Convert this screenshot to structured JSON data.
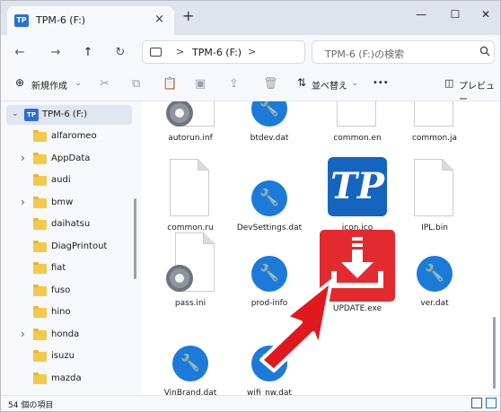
{
  "window": {
    "tab_title": "TPM-6 (F:)",
    "tab_close": "×",
    "new_tab": "+",
    "minimize": "—",
    "maximize": "☐",
    "close": "✕"
  },
  "nav": {
    "back": "←",
    "forward": "→",
    "up": "↑",
    "refresh": "↻"
  },
  "address": {
    "separator": ">",
    "crumb": "TPM-6 (F:)",
    "trail_separator": ">"
  },
  "search": {
    "placeholder": "TPM-6 (F:)の検索",
    "icon": "search-icon"
  },
  "commandbar": {
    "new_label": "新規作成",
    "new_icon": "⊕",
    "sort_label": "並べ替え",
    "more": "•••",
    "preview_label": "プレビュー",
    "disabled_icons": [
      "cut-icon",
      "copy-icon",
      "paste-icon",
      "rename-icon",
      "share-icon",
      "delete-icon"
    ]
  },
  "sidebar": {
    "drive": {
      "label": "TPM-6 (F:)",
      "badge": "TP"
    },
    "items": [
      {
        "label": "alfaromeo",
        "has_children": false
      },
      {
        "label": "AppData",
        "has_children": true
      },
      {
        "label": "audi",
        "has_children": false
      },
      {
        "label": "bmw",
        "has_children": true
      },
      {
        "label": "daihatsu",
        "has_children": false
      },
      {
        "label": "DiagPrintout",
        "has_children": false
      },
      {
        "label": "fiat",
        "has_children": false
      },
      {
        "label": "fuso",
        "has_children": false
      },
      {
        "label": "hino",
        "has_children": false
      },
      {
        "label": "honda",
        "has_children": true
      },
      {
        "label": "isuzu",
        "has_children": false
      },
      {
        "label": "mazda",
        "has_children": false
      }
    ]
  },
  "files": [
    {
      "name": "autorun.inf",
      "icon": "gear-icon"
    },
    {
      "name": "btdev.dat",
      "icon": "wrench-icon"
    },
    {
      "name": "common.en",
      "icon": "document-icon"
    },
    {
      "name": "common.ja",
      "icon": "document-icon"
    },
    {
      "name": "common.ru",
      "icon": "document-icon"
    },
    {
      "name": "DevSettings.dat",
      "icon": "wrench-icon"
    },
    {
      "name": "icon.ico",
      "icon": "tp-logo-icon",
      "logo_text": "TP"
    },
    {
      "name": "IPL.bin",
      "icon": "document-icon"
    },
    {
      "name": "pass.ini",
      "icon": "gear-icon"
    },
    {
      "name": "prod-info",
      "icon": "wrench-icon"
    },
    {
      "name": "UPDATE.exe",
      "icon": "download-icon"
    },
    {
      "name": "ver.dat",
      "icon": "wrench-icon"
    },
    {
      "name": "VinBrand.dat",
      "icon": "wrench-icon"
    },
    {
      "name": "wifi_nw.dat",
      "icon": "wrench-icon"
    }
  ],
  "status": {
    "count_text": "54 個の項目"
  },
  "colors": {
    "accent": "#1c7ad8",
    "update_red": "#e32a2f",
    "pointer_arrow": "#e0191f",
    "folder": "#f2c94c"
  }
}
